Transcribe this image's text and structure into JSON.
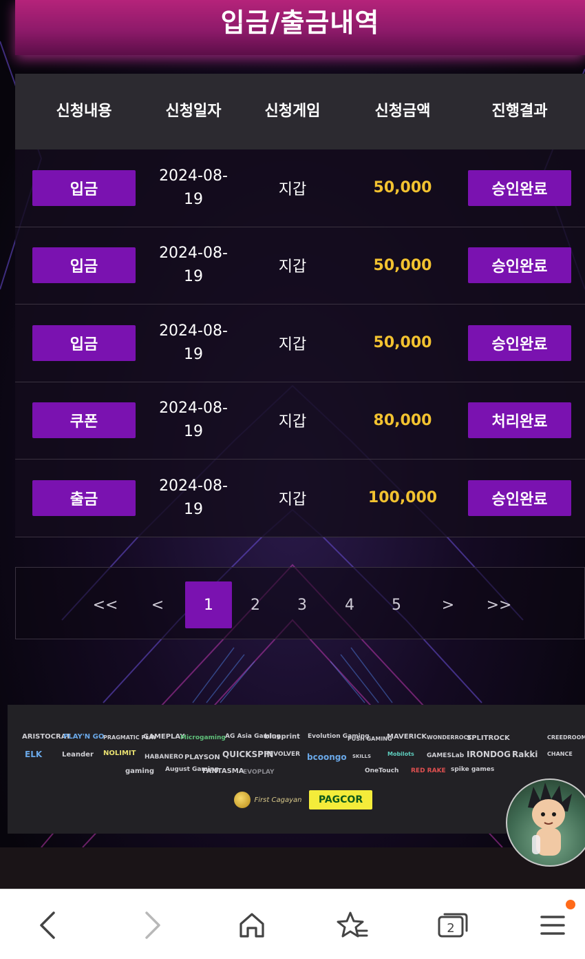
{
  "header": {
    "title": "입금/출금내역"
  },
  "table": {
    "columns": [
      "신청내용",
      "신청일자",
      "신청게임",
      "신청금액",
      "진행결과"
    ],
    "rows": [
      {
        "type": "입금",
        "date": "2024-08-19",
        "game": "지갑",
        "amount": "50,000",
        "status": "승인완료"
      },
      {
        "type": "입금",
        "date": "2024-08-19",
        "game": "지갑",
        "amount": "50,000",
        "status": "승인완료"
      },
      {
        "type": "입금",
        "date": "2024-08-19",
        "game": "지갑",
        "amount": "50,000",
        "status": "승인완료"
      },
      {
        "type": "쿠폰",
        "date": "2024-08-19",
        "game": "지갑",
        "amount": "80,000",
        "status": "처리완료"
      },
      {
        "type": "출금",
        "date": "2024-08-19",
        "game": "지갑",
        "amount": "100,000",
        "status": "승인완료"
      }
    ]
  },
  "pagination": {
    "first": "<<",
    "prev": "<",
    "pages": [
      "1",
      "2",
      "3",
      "4",
      "5"
    ],
    "current": "1",
    "next": ">",
    "last": ">>"
  },
  "footer": {
    "providers_row1": [
      "ARISTOCRAT",
      "PLAY'N GO",
      "PRAGMATIC PLAY",
      "GAMEPLAY",
      "Microgaming",
      "AG Asia Gaming",
      "blueprint",
      "Evolution Gaming",
      "PUSH GAMING",
      "MAVERICK",
      "WONDERROCK",
      "SPLITROCK",
      "CREEDROOMZ"
    ],
    "providers_row2": [
      "ELK",
      "Leander",
      "NOLIMIT",
      "HABANERO",
      "PLAYSON",
      "QUICKSPIN",
      "REVOLVER",
      "bcoongo",
      "SKILLS",
      "Mobilots",
      "GAMESLab",
      "IRONDOG",
      "Rakki",
      "CHANCE"
    ],
    "providers_row3": [
      "gaming",
      "August Gaming",
      "FANTASMA",
      "EVOPLAY",
      "OneTouch",
      "RED RAKE",
      "spike games"
    ],
    "licenses": [
      "First Cagayan",
      "PAGCOR"
    ]
  },
  "browser_nav": {
    "items": [
      "back-icon",
      "forward-icon",
      "home-icon",
      "bookmark-star-icon",
      "tabs-icon",
      "menu-icon"
    ],
    "tab_count": "2",
    "accent": "#ff6a1a"
  },
  "colors": {
    "accent_purple": "#7a12b0",
    "amount_gold": "#f2c230",
    "header_pink": "#b5237a"
  }
}
